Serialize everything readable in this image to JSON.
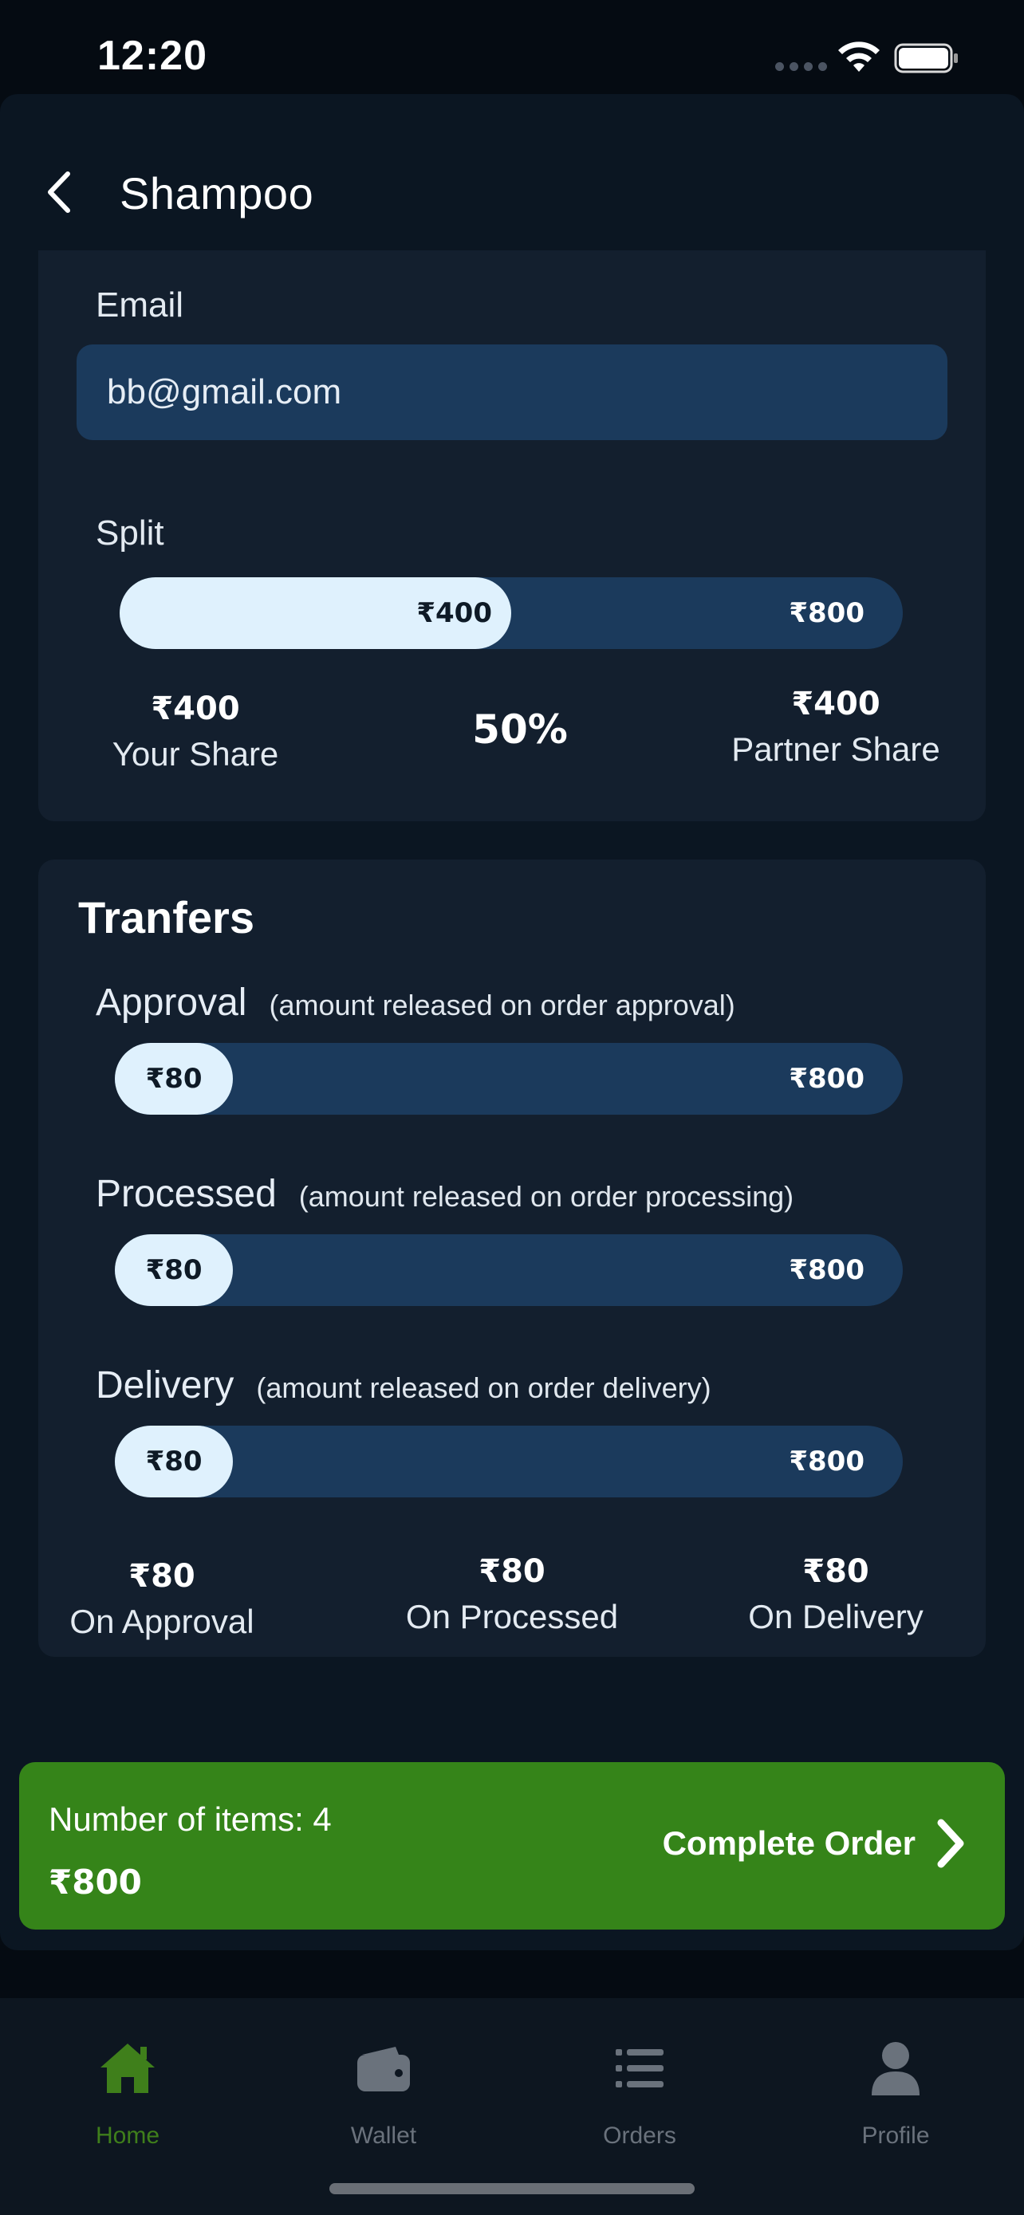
{
  "status_bar": {
    "time": "12:20"
  },
  "header": {
    "title": "Shampoo"
  },
  "email": {
    "label": "Email",
    "value": "bb@gmail.com"
  },
  "split": {
    "label": "Split",
    "slider_value": "₹400",
    "slider_max": "₹800",
    "fraction": 0.5,
    "your_share_amount": "₹400",
    "your_share_label": "Your Share",
    "percent": "50%",
    "partner_share_amount": "₹400",
    "partner_share_label": "Partner Share"
  },
  "transfers": {
    "title": "Tranfers",
    "items": [
      {
        "name": "Approval",
        "hint": "(amount released on order approval)",
        "value": "₹80",
        "max": "₹800",
        "fraction": 0.1
      },
      {
        "name": "Processed",
        "hint": "(amount released on order processing)",
        "value": "₹80",
        "max": "₹800",
        "fraction": 0.1
      },
      {
        "name": "Delivery",
        "hint": "(amount released on order delivery)",
        "value": "₹80",
        "max": "₹800",
        "fraction": 0.1
      }
    ],
    "summary": [
      {
        "amount": "₹80",
        "label": "On Approval"
      },
      {
        "amount": "₹80",
        "label": "On Processed"
      },
      {
        "amount": "₹80",
        "label": "On Delivery"
      }
    ]
  },
  "order": {
    "count_label": "Number of items: 4",
    "total": "₹800",
    "button_label": "Complete Order"
  },
  "tabs": [
    {
      "label": "Home",
      "icon": "home-icon",
      "active": true
    },
    {
      "label": "Wallet",
      "icon": "wallet-icon",
      "active": false
    },
    {
      "label": "Orders",
      "icon": "list-icon",
      "active": false
    },
    {
      "label": "Profile",
      "icon": "user-icon",
      "active": false
    }
  ],
  "colors": {
    "accent_green": "#358419",
    "active_tab": "#3f7f1b",
    "track": "#1b3a5c",
    "fill": "#dff1fd"
  }
}
